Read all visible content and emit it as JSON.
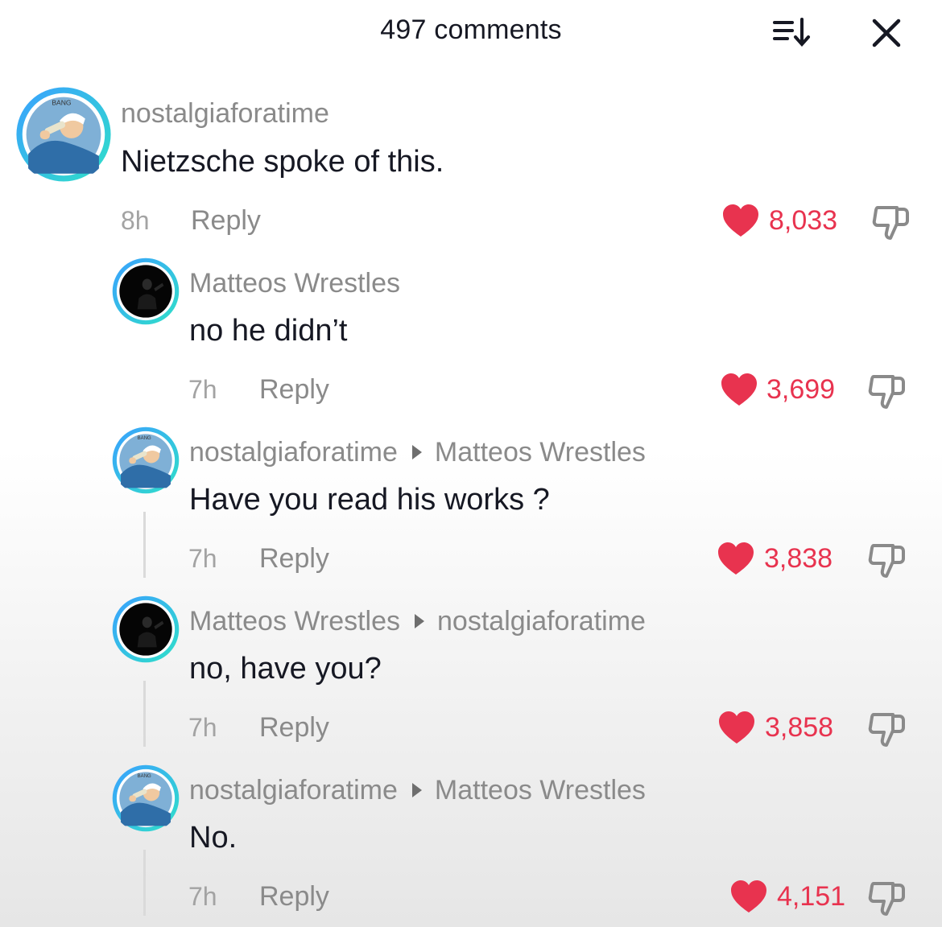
{
  "header": {
    "title": "497 comments",
    "sort_icon": "sort-icon",
    "close_icon": "close-icon"
  },
  "colors": {
    "like": "#e8334f",
    "ring_start": "#3aa0ff",
    "ring_end": "#2fe0c8",
    "meta": "#8a8a8a",
    "text": "#161823"
  },
  "comments": [
    {
      "username": "nostalgiaforatime",
      "reply_to": "",
      "text": "Nietzsche spoke of this.",
      "time": "8h",
      "reply_label": "Reply",
      "likes": "8,033"
    },
    {
      "username": "Matteos Wrestles",
      "reply_to": "",
      "text": "no he didn’t",
      "time": "7h",
      "reply_label": "Reply",
      "likes": "3,699"
    },
    {
      "username": "nostalgiaforatime",
      "reply_to": "Matteos Wrestles",
      "text": "Have you read his works ?",
      "time": "7h",
      "reply_label": "Reply",
      "likes": "3,838"
    },
    {
      "username": "Matteos Wrestles",
      "reply_to": "nostalgiaforatime",
      "text": "no, have you?",
      "time": "7h",
      "reply_label": "Reply",
      "likes": "3,858"
    },
    {
      "username": "nostalgiaforatime",
      "reply_to": "Matteos Wrestles",
      "text": "No.",
      "time": "7h",
      "reply_label": "Reply",
      "likes": "4,151"
    }
  ]
}
